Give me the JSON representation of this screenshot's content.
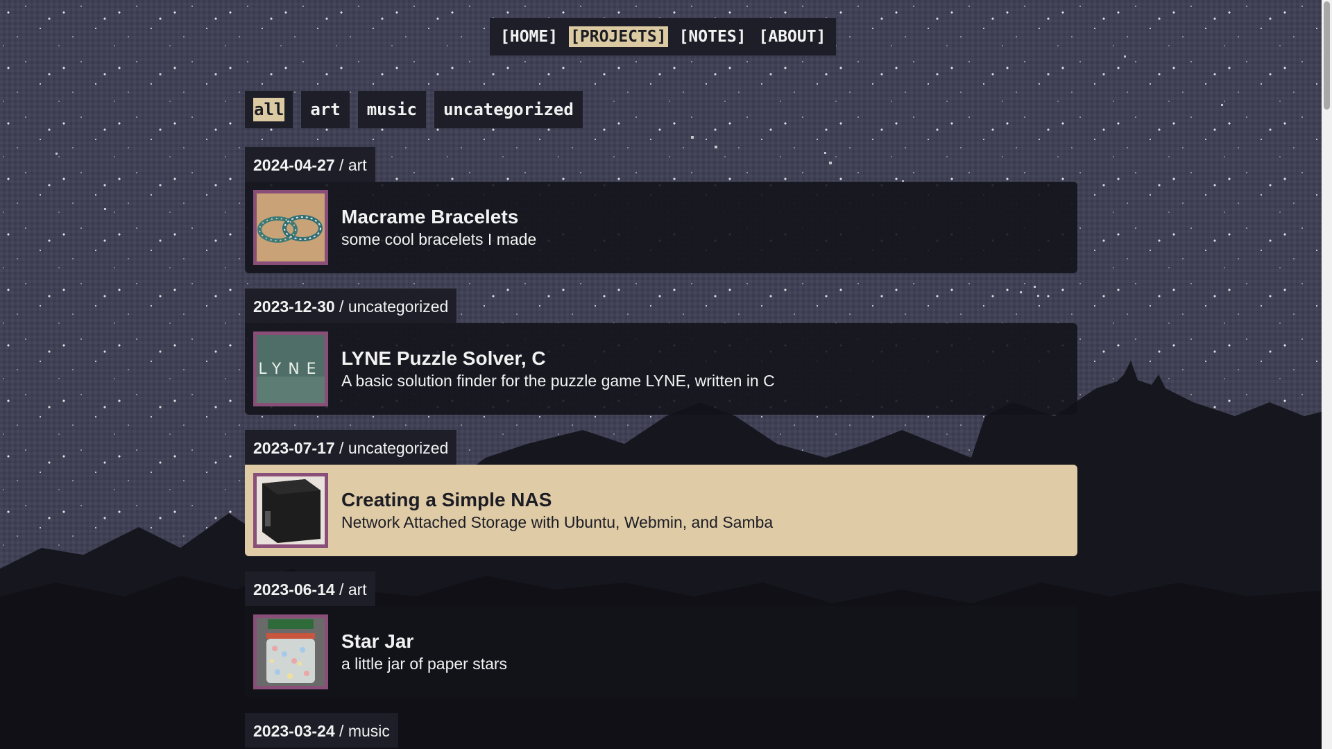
{
  "nav": {
    "items": [
      {
        "label": "[HOME]",
        "active": false
      },
      {
        "label": "[PROJECTS]",
        "active": true
      },
      {
        "label": "[NOTES]",
        "active": false
      },
      {
        "label": "[ABOUT]",
        "active": false
      }
    ]
  },
  "filters": {
    "items": [
      {
        "label": "all",
        "active": true
      },
      {
        "label": "art",
        "active": false
      },
      {
        "label": "music",
        "active": false
      },
      {
        "label": "uncategorized",
        "active": false
      }
    ]
  },
  "projects": [
    {
      "date": "2024-04-27",
      "category": "/ art",
      "title": "Macrame Bracelets",
      "description": "some cool bracelets I made",
      "thumbnail": "bracelets-photo",
      "highlighted": false
    },
    {
      "date": "2023-12-30",
      "category": "/ uncategorized",
      "title": "LYNE Puzzle Solver, C",
      "description": "A basic solution finder for the puzzle game LYNE, written in C",
      "thumbnail": "lyne-logo",
      "thumb_text": "LYNE",
      "highlighted": false
    },
    {
      "date": "2023-07-17",
      "category": "/ uncategorized",
      "title": "Creating a Simple NAS",
      "description": "Network Attached Storage with Ubuntu, Webmin, and Samba",
      "thumbnail": "nas-box-photo",
      "highlighted": true
    },
    {
      "date": "2023-06-14",
      "category": "/ art",
      "title": "Star Jar",
      "description": "a little jar of paper stars",
      "thumbnail": "star-jar-photo",
      "highlighted": false
    },
    {
      "date": "2023-03-24",
      "category": "/ music",
      "title": "",
      "description": "",
      "thumbnail": "",
      "highlighted": false
    }
  ],
  "colors": {
    "accent": "#dccba2",
    "panel": "#1e1e28",
    "thumb_border": "#8a4f78",
    "sky": "#3a3b4f"
  }
}
